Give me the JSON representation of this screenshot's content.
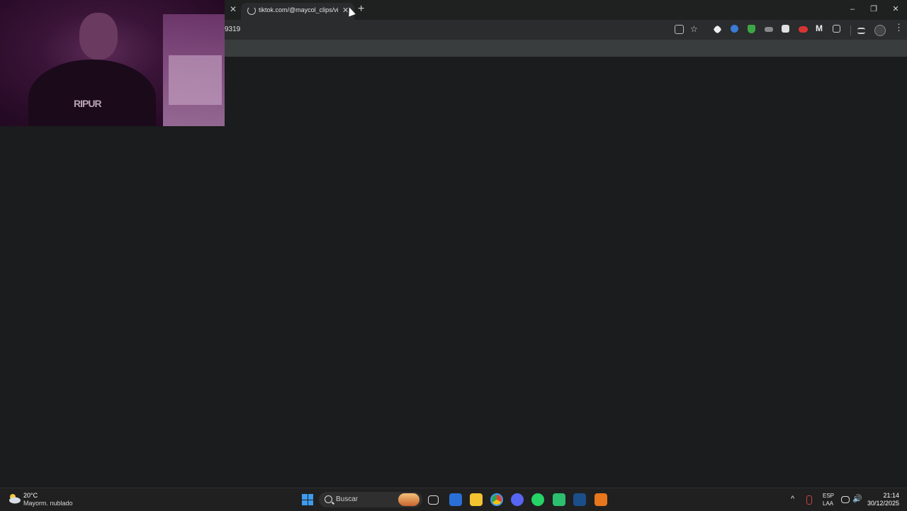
{
  "browser": {
    "tab_title": "tiktok.com/@maycol_clips/vide",
    "close_glyph": "✕",
    "new_tab_glyph": "+",
    "url": "9319",
    "window_controls": {
      "minimize": "–",
      "maximize": "❐",
      "close": "✕"
    }
  },
  "webcam": {
    "shirt_logo": "RIPUR"
  },
  "taskbar": {
    "weather": {
      "temp": "20°C",
      "desc": "Mayorm. nublado"
    },
    "search_label": "Buscar",
    "apps": [
      "task-view",
      "microsoft-store",
      "file-explorer",
      "chrome",
      "discord",
      "whatsapp",
      "app-green",
      "steam",
      "app-orange"
    ],
    "tray": {
      "lang_top": "ESP",
      "lang_bottom": "LAA",
      "expand_glyph": "^"
    },
    "clock": {
      "time": "21:14",
      "date": "30/12/2025"
    }
  },
  "colors": {
    "accent": "#3d9bf0",
    "bg": "#1b1c1d"
  }
}
